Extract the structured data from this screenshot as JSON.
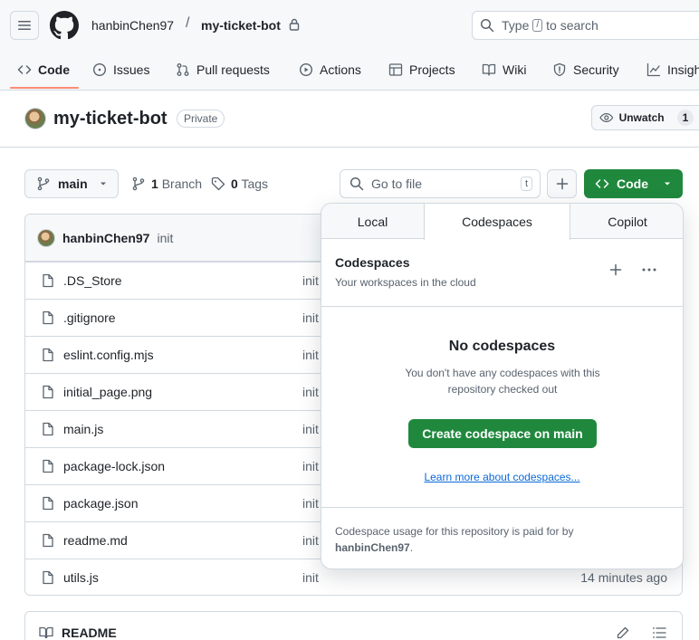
{
  "header": {
    "owner": "hanbinChen97",
    "separator": "/",
    "repo": "my-ticket-bot",
    "search_prefix": "Type",
    "search_key": "/",
    "search_suffix": "to search"
  },
  "tabs": [
    {
      "label": "Code",
      "icon": "code-icon"
    },
    {
      "label": "Issues",
      "icon": "issue-icon"
    },
    {
      "label": "Pull requests",
      "icon": "pull-request-icon"
    },
    {
      "label": "Actions",
      "icon": "play-icon"
    },
    {
      "label": "Projects",
      "icon": "table-icon"
    },
    {
      "label": "Wiki",
      "icon": "book-icon"
    },
    {
      "label": "Security",
      "icon": "shield-icon"
    },
    {
      "label": "Insigh",
      "icon": "graph-icon"
    }
  ],
  "repo_bar": {
    "name": "my-ticket-bot",
    "visibility": "Private",
    "unwatch_label": "Unwatch",
    "watch_count": "1"
  },
  "branch_row": {
    "branch": "main",
    "branch_count": "1",
    "branch_label": "Branch",
    "tag_count": "0",
    "tag_label": "Tags",
    "goto_placeholder": "Go to file",
    "goto_key": "t",
    "code_label": "Code"
  },
  "commit": {
    "author": "hanbinChen97",
    "message": "init"
  },
  "files": [
    {
      "name": ".DS_Store",
      "message": "init",
      "time": ""
    },
    {
      "name": ".gitignore",
      "message": "init",
      "time": ""
    },
    {
      "name": "eslint.config.mjs",
      "message": "init",
      "time": ""
    },
    {
      "name": "initial_page.png",
      "message": "init",
      "time": ""
    },
    {
      "name": "main.js",
      "message": "init",
      "time": ""
    },
    {
      "name": "package-lock.json",
      "message": "init",
      "time": ""
    },
    {
      "name": "package.json",
      "message": "init",
      "time": ""
    },
    {
      "name": "readme.md",
      "message": "init",
      "time": ""
    },
    {
      "name": "utils.js",
      "message": "init",
      "time": "14 minutes ago"
    }
  ],
  "readme": {
    "title": "README"
  },
  "dropdown": {
    "tabs": [
      "Local",
      "Codespaces",
      "Copilot"
    ],
    "active_tab": "Codespaces",
    "title": "Codespaces",
    "subtitle": "Your workspaces in the cloud",
    "empty_title": "No codespaces",
    "empty_text": "You don't have any codespaces with this repository checked out",
    "create_label": "Create codespace on main",
    "learn_label": "Learn more about codespaces...",
    "footer_text": "Codespace usage for this repository is paid for by",
    "footer_user": "hanbinChen97",
    "footer_end": "."
  },
  "colors": {
    "primary_green": "#1f883d",
    "link_blue": "#0969da",
    "active_tab_underline": "#fd8c73",
    "border": "#d1d9e0"
  }
}
